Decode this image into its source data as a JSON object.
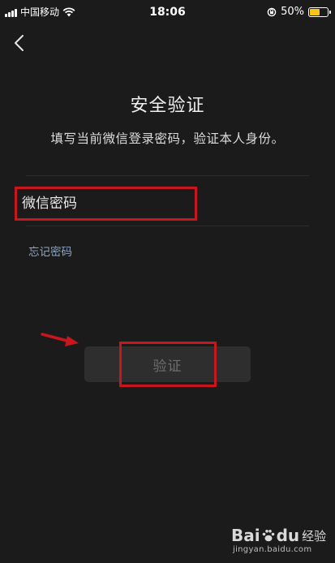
{
  "status_bar": {
    "carrier": "中国移动",
    "time": "18:06",
    "battery_percent_label": "50%",
    "battery_level": 0.5,
    "battery_color": "#f5c518"
  },
  "nav": {
    "back_icon": "chevron-left-icon"
  },
  "main": {
    "title": "安全验证",
    "subtitle": "填写当前微信登录密码，验证本人身份。",
    "password_placeholder": "微信密码",
    "forgot_link": "忘记密码",
    "verify_button": "验证"
  },
  "annotations": {
    "highlight_color": "#c8161e",
    "arrow_icon": "red-arrow-icon"
  },
  "watermark": {
    "brand": "Bai",
    "brand_suffix": "du",
    "brand_cn": "经验",
    "url": "jingyan.baidu.com"
  },
  "colors": {
    "background": "#1b1b1b",
    "link": "#8fa6c4",
    "button_bg": "#2e2e2e",
    "button_text": "#6e6e6e"
  }
}
